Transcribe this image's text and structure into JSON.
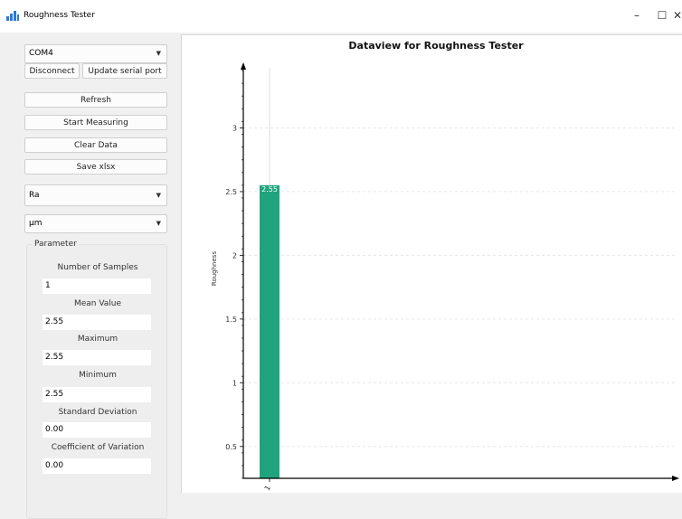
{
  "window": {
    "title": "Roughness Tester",
    "controls": {
      "minimize": "–",
      "maximize": "☐",
      "close": "✕"
    }
  },
  "sidebar": {
    "port": "COM4",
    "disconnect_label": "Disconnect",
    "update_port_label": "Update serial port",
    "refresh_label": "Refresh",
    "start_label": "Start Measuring",
    "clear_label": "Clear Data",
    "save_label": "Save xlsx",
    "metric": "Ra",
    "unit": "μm"
  },
  "parameters": {
    "group_title": "Parameter",
    "items": [
      {
        "label": "Number of Samples",
        "value": "1"
      },
      {
        "label": "Mean Value",
        "value": "2.55"
      },
      {
        "label": "Maximum",
        "value": "2.55"
      },
      {
        "label": "Minimum",
        "value": "2.55"
      },
      {
        "label": "Standard Deviation",
        "value": "0.00"
      },
      {
        "label": "Coefficient of Variation",
        "value": "0.00"
      }
    ]
  },
  "chart_data": {
    "type": "bar",
    "title": "Dataview for Roughness Tester",
    "xlabel": "",
    "ylabel": "Roughness",
    "categories": [
      "1"
    ],
    "values": [
      2.55
    ],
    "data_labels": [
      "2.55"
    ],
    "yticks": [
      "0.5",
      "1",
      "1.5",
      "2",
      "2.5",
      "3"
    ],
    "ylim": [
      0.25,
      3.5
    ],
    "grid": true,
    "bar_color": "#1fa47e"
  }
}
